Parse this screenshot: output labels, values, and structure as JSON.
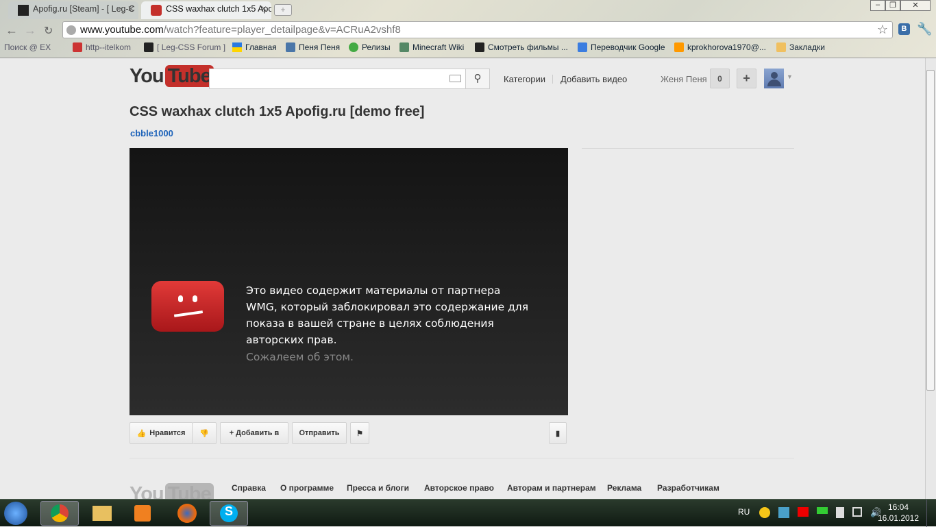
{
  "browser": {
    "tabs": [
      {
        "label": "Apofig.ru [Steam] - [ Leg-C",
        "active": false
      },
      {
        "label": "CSS waxhax clutch 1x5 Apof",
        "active": true
      }
    ],
    "url_host": "www.youtube.com",
    "url_path": "/watch?feature=player_detailpage&v=ACRuA2vshf8",
    "bookmarks": [
      "Поиск @ EX",
      "http--itelkom",
      "[ Leg-CSS Forum ]",
      "Главная",
      "Пеня Пеня",
      "Релизы",
      "Minecraft Wiki",
      "Смотреть фильмы ...",
      "Переводчик Google",
      "kprokhorova1970@...",
      "Закладки"
    ]
  },
  "youtube": {
    "logo_you": "You",
    "logo_tube": "Tube",
    "search_placeholder": "",
    "nav": {
      "categories": "Категории",
      "upload": "Добавить видео"
    },
    "user": {
      "name": "Женя Пеня",
      "notifications": "0",
      "plus": "+"
    },
    "video_title": "CSS waxhax clutch 1x5 Apofig.ru [demo free]",
    "channel": "cbble1000",
    "blocked_message": "Это видео содержит материалы от партнера WMG, который заблокировал это содержание для показа в вашей стране в целях соблюдения авторских прав.",
    "sorry": "Сожалеем об этом.",
    "actions": {
      "like": "Нравится",
      "add_to": "+ Добавить в",
      "share": "Отправить"
    },
    "footer_links": [
      "Справка",
      "О программе",
      "Пресса и блоги",
      "Авторское право",
      "Авторам и партнерам",
      "Реклама",
      "Разработчикам"
    ]
  },
  "taskbar": {
    "lang": "RU",
    "time": "16:04",
    "date": "16.01.2012"
  }
}
